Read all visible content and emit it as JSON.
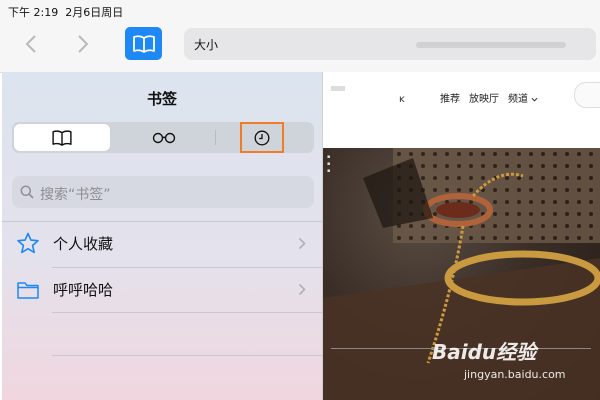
{
  "status": {
    "time": "下午 2:19",
    "date": "2月6日周日"
  },
  "toolbar": {
    "address_text": "大小"
  },
  "sidebar": {
    "title": "书签",
    "tabs": [
      {
        "name": "bookmarks",
        "icon": "book-icon",
        "selected": true
      },
      {
        "name": "reading-list",
        "icon": "glasses-icon",
        "selected": false
      },
      {
        "name": "history",
        "icon": "clock-icon",
        "selected": false,
        "highlighted": true
      }
    ],
    "search": {
      "placeholder": "搜索“书签”"
    },
    "items": [
      {
        "label": "个人收藏",
        "icon": "star-icon"
      },
      {
        "label": "呼呼哈哈",
        "icon": "folder-icon"
      }
    ]
  },
  "webpage": {
    "nav": [
      "推荐",
      "放映厅",
      "频道"
    ],
    "nav_glyph": "ĸ"
  },
  "watermark": {
    "logo": "Baidu经验",
    "sub": "jingyan.baidu.com"
  },
  "colors": {
    "accent": "#1e88f5",
    "highlight": "#f07c2a",
    "icon_blue": "#1e88f5"
  }
}
